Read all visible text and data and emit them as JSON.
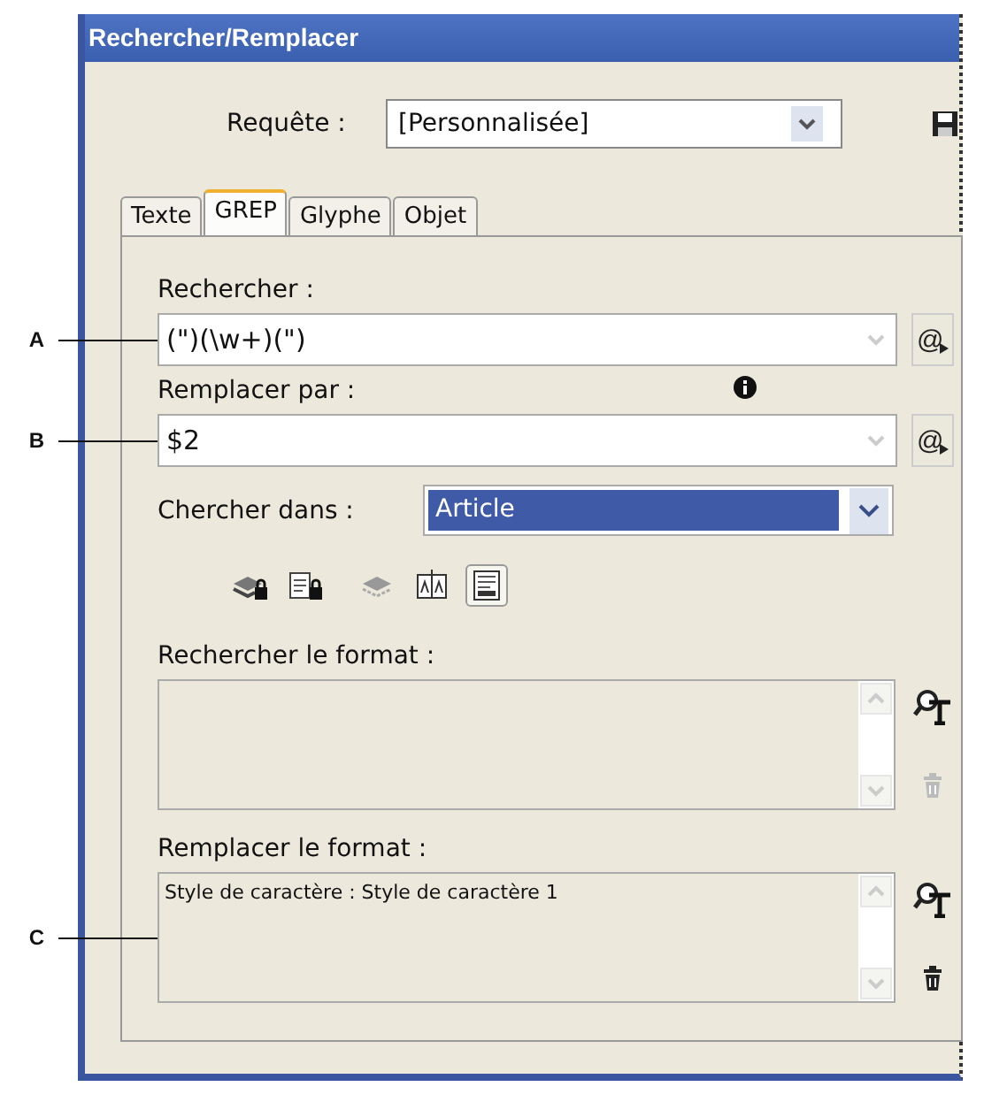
{
  "window": {
    "title": "Rechercher/Remplacer"
  },
  "query": {
    "label": "Requête :",
    "value": "[Personnalisée]"
  },
  "tabs": [
    {
      "label": "Texte",
      "selected": false
    },
    {
      "label": "GREP",
      "selected": true
    },
    {
      "label": "Glyphe",
      "selected": false
    },
    {
      "label": "Objet",
      "selected": false
    }
  ],
  "find": {
    "label": "Rechercher :",
    "value": "(\")(\\w+)(\")",
    "callout": "A",
    "special_button": "@"
  },
  "replace": {
    "label": "Remplacer par :",
    "value": "$2",
    "callout": "B",
    "special_button": "@"
  },
  "search_in": {
    "label": "Chercher dans :",
    "value": "Article"
  },
  "options": [
    {
      "kind": "locked-layers",
      "selected": false
    },
    {
      "kind": "locked-stories",
      "selected": false
    },
    {
      "kind": "hidden-layers",
      "selected": false
    },
    {
      "kind": "master-pages",
      "selected": false
    },
    {
      "kind": "footnotes",
      "selected": true
    }
  ],
  "formats": [
    {
      "label": "Rechercher le format :",
      "trash_disabled": true
    },
    {
      "label": "Remplacer le format :",
      "text": "Style de caractère : Style de caractère 1",
      "callout": "C",
      "trash_disabled": false
    }
  ]
}
